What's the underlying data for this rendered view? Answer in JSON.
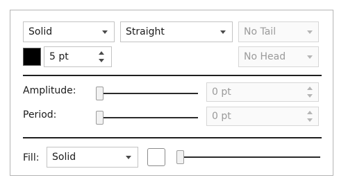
{
  "line": {
    "style": "Solid",
    "path": "Straight",
    "tail": "No Tail",
    "head": "No Head",
    "width": "5 pt",
    "color": "#000000"
  },
  "wave": {
    "amplitude_label": "Amplitude:",
    "amplitude_value": "0 pt",
    "amplitude_level": 0,
    "period_label": "Period:",
    "period_value": "0 pt",
    "period_level": 0
  },
  "fill": {
    "label": "Fill:",
    "style": "Solid",
    "color": "#ffffff",
    "opacity_level": 0
  },
  "icons": [
    "dropdown-caret-icon",
    "stepper-arrows-icon"
  ]
}
